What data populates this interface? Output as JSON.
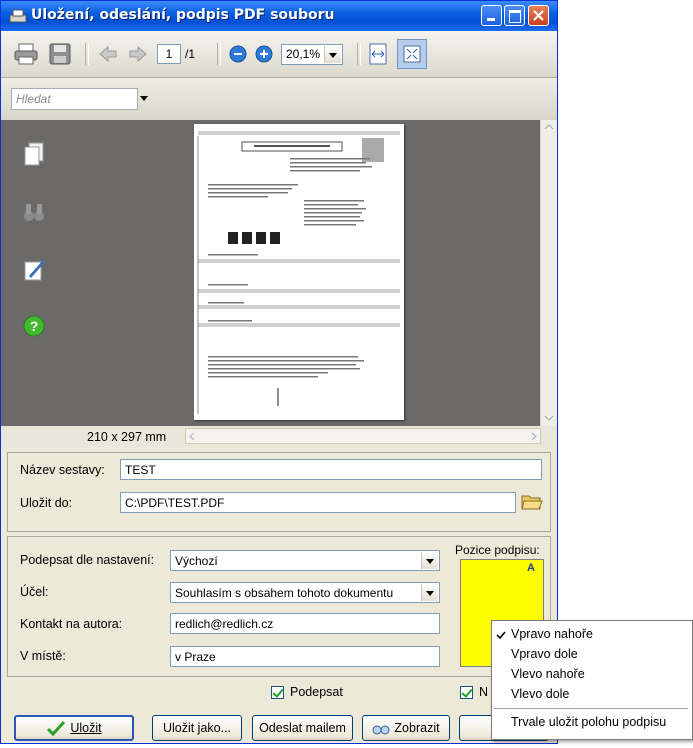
{
  "window": {
    "title": "Uložení, odeslání, podpis PDF souboru"
  },
  "toolbar": {
    "page_current": "1",
    "page_total": "/1",
    "zoom": "20,1%"
  },
  "search": {
    "placeholder": "Hledat"
  },
  "viewer": {
    "page_size": "210 x 297 mm"
  },
  "form": {
    "report_name_label": "Název sestavy:",
    "report_name": "TEST",
    "save_to_label": "Uložit do:",
    "save_to": "C:\\PDF\\TEST.PDF",
    "sign_by_label": "Podepsat dle nastavení:",
    "sign_by": "Výchozí",
    "purpose_label": "Účel:",
    "purpose": "Souhlasím s obsahem tohoto dokumentu",
    "contact_label": "Kontakt na autora:",
    "contact": "redlich@redlich.cz",
    "location_label": "V místě:",
    "location": "v Praze",
    "signature_position_label": "Pozice podpisu:",
    "signature_marker": "A",
    "sign_checkbox": "Podepsat",
    "second_checkbox_partial": "N"
  },
  "buttons": {
    "save": "Uložit",
    "save_as": "Uložit jako...",
    "send_mail": "Odeslat mailem",
    "show": "Zobrazit"
  },
  "context_menu": {
    "items": [
      "Vpravo nahoře",
      "Vpravo dole",
      "Vlevo nahoře",
      "Vlevo dole"
    ],
    "checked_index": 0,
    "persist": "Trvale uložit polohu podpisu"
  },
  "colors": {
    "titlebar": "#0a5fe0",
    "viewer_bg": "#6c6a68",
    "signature_box": "#ffff00",
    "panel_bg": "#ece9d8"
  }
}
